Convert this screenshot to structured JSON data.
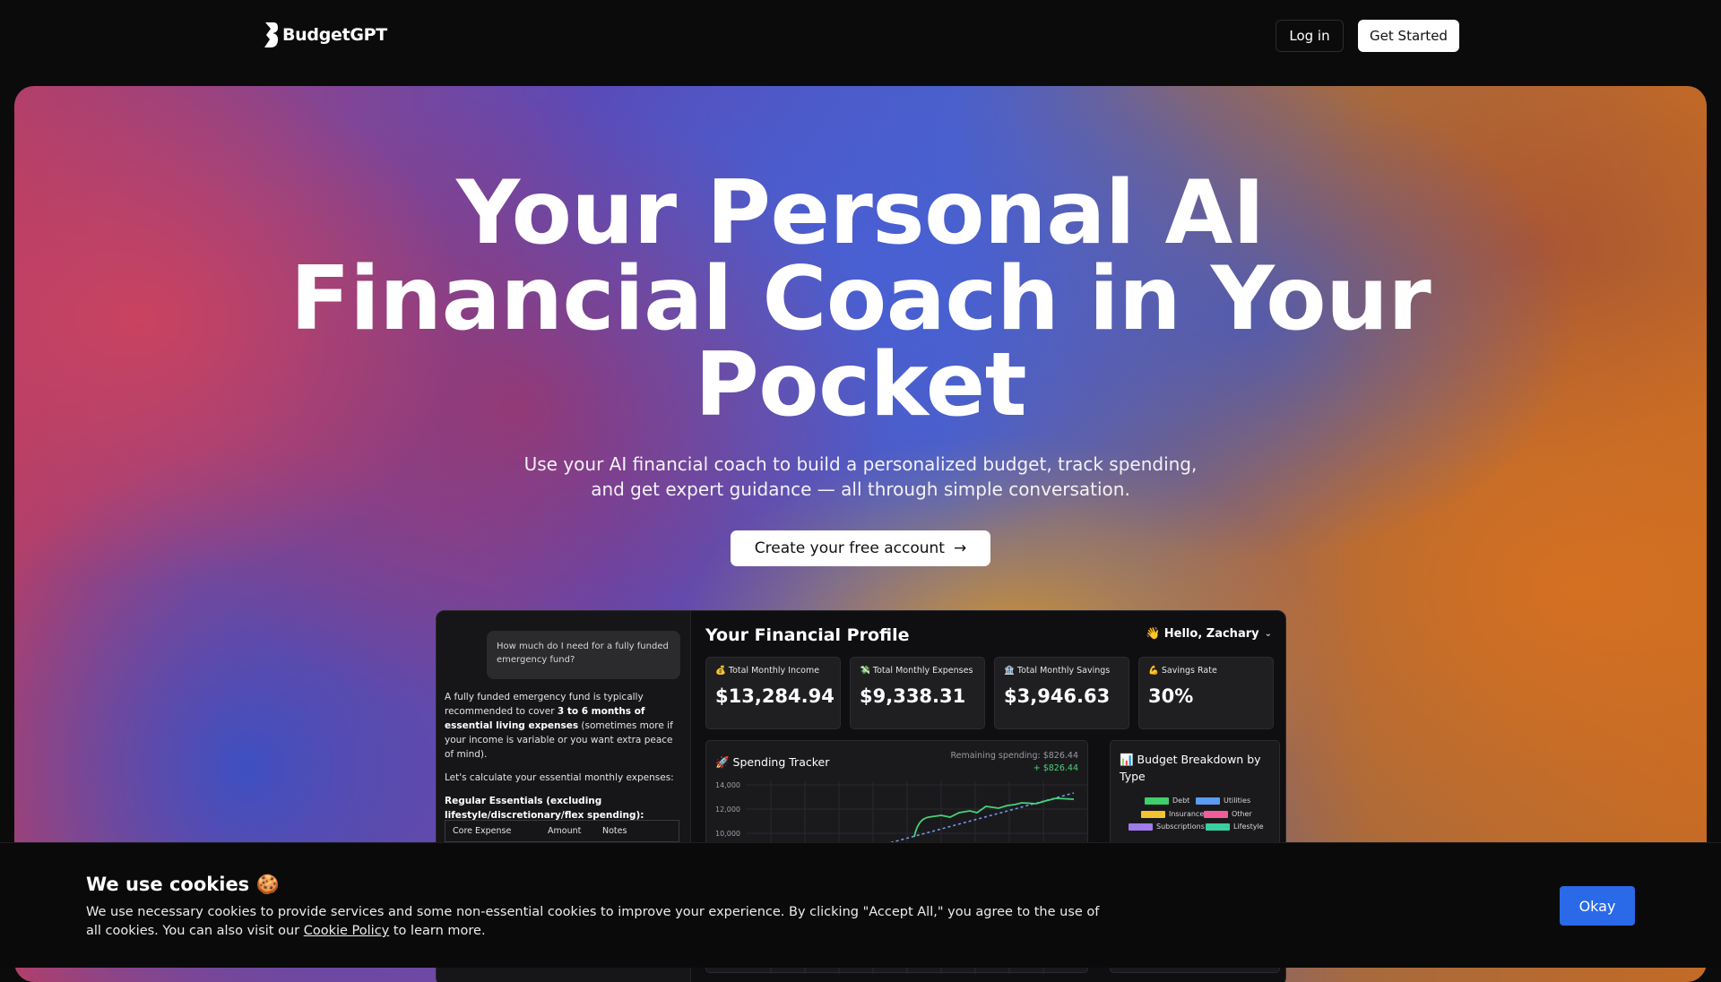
{
  "header": {
    "logo_text": "BudgetGPT",
    "login_label": "Log in",
    "get_started_label": "Get Started"
  },
  "hero": {
    "title_lines": [
      "Your Personal AI",
      "Financial Coach in Your",
      "Pocket"
    ],
    "subtitle_lines": [
      "Use your AI financial coach to build a personalized budget, track spending,",
      "and get expert guidance — all through simple conversation."
    ],
    "cta_label": "Create your free account",
    "cta_icon": "arrow-right-icon"
  },
  "preview": {
    "chat": {
      "user_question": "How much do I need for a fully funded emergency fund?",
      "answer_p1_a": "A fully funded emergency fund is typically recommended to cover ",
      "answer_p1_bold": "3 to 6 months of essential living expenses",
      "answer_p1_b": " (sometimes more if your income is variable or you want extra peace of mind).",
      "answer_p2": "Let's calculate your essential monthly expenses:",
      "answer_heading": "Regular Essentials (excluding lifestyle/discretionary/flex spending):",
      "table_headers": [
        "Core Expense",
        "Amount",
        "Notes"
      ]
    },
    "profile_title": "Your Financial Profile",
    "greeting": "👋 Hello, Zachary",
    "stats": [
      {
        "icon": "💰",
        "label": "Total Monthly Income",
        "value": "$13,284.94"
      },
      {
        "icon": "💸",
        "label": "Total Monthly Expenses",
        "value": "$9,338.31"
      },
      {
        "icon": "🏦",
        "label": "Total Monthly Savings",
        "value": "$3,946.63"
      },
      {
        "icon": "💪",
        "label": "Savings Rate",
        "value": "30%"
      }
    ],
    "tracker": {
      "title": "🚀 Spending Tracker",
      "remaining_label": "Remaining spending: $826.44",
      "remaining_delta": "+ $826.44",
      "y_ticks": [
        "14,000",
        "12,000",
        "10,000"
      ]
    },
    "breakdown": {
      "title": "📊 Budget Breakdown by Type",
      "legend": [
        {
          "name": "Debt",
          "color": "#3ecf6a"
        },
        {
          "name": "Utilities",
          "color": "#5b9cf0"
        },
        {
          "name": "Insurance",
          "color": "#f2c230"
        },
        {
          "name": "Other",
          "color": "#ef5d9b"
        },
        {
          "name": "Subscriptions",
          "color": "#a17bea"
        },
        {
          "name": "Lifestyle",
          "color": "#38d0a0"
        }
      ]
    }
  },
  "cookie": {
    "title": "We use cookies 🍪",
    "text_a": "We use necessary cookies to provide services and some non-essential cookies to improve your experience. By clicking \"Accept All,\" you agree to the use of all cookies. You can also visit our ",
    "link_label": "Cookie Policy",
    "text_b": " to learn more.",
    "button_label": "Okay"
  },
  "colors": {
    "accent_blue": "#2a6ae8",
    "positive_green": "#4fd07a"
  }
}
